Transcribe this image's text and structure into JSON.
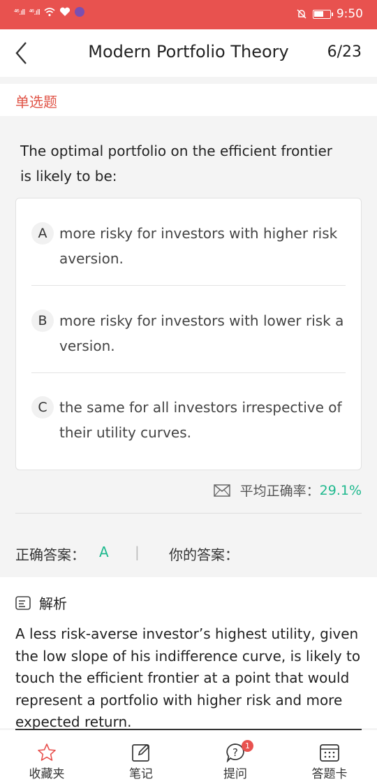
{
  "status_bar": {
    "signal_1": "⁴⁶.ıll",
    "signal_2": "⁴⁶.ıll",
    "time": "9:50",
    "battery_level": 0.6,
    "accent_color": "#e8524f"
  },
  "header": {
    "title": "Modern Portfolio Theory",
    "progress": "6/23"
  },
  "question": {
    "type_label": "单选题",
    "text": "The optimal portfolio on the efficient frontier is likely to be:",
    "options": [
      {
        "letter": "A",
        "text": "more risky for investors with higher risk aversion."
      },
      {
        "letter": "B",
        "text": "more risky for investors with lower risk aversion."
      },
      {
        "letter": "C",
        "text": "the same for all investors irrespective of their utility curves."
      }
    ],
    "accuracy_label": "平均正确率：",
    "accuracy_value": "29.1%"
  },
  "answer": {
    "correct_label": "正确答案：",
    "correct_value": "A",
    "separator": "|",
    "your_label": "你的答案："
  },
  "analysis": {
    "title": "解析",
    "text": "A less risk-averse investor’s highest utility, given the low slope of his indifference curve, is likely to touch the efficient frontier at a point that would represent a portfolio with higher risk and more expected return."
  },
  "bottom_nav": {
    "items": [
      {
        "label": "收藏夹",
        "icon": "star-icon"
      },
      {
        "label": "笔记",
        "icon": "edit-note-icon"
      },
      {
        "label": "提问",
        "icon": "question-bubble-icon",
        "badge": "1"
      },
      {
        "label": "答题卡",
        "icon": "answer-card-icon"
      }
    ]
  },
  "colors": {
    "primary_red": "#e8524f",
    "type_label_red": "#e05346",
    "success_green": "#1fb98e"
  }
}
